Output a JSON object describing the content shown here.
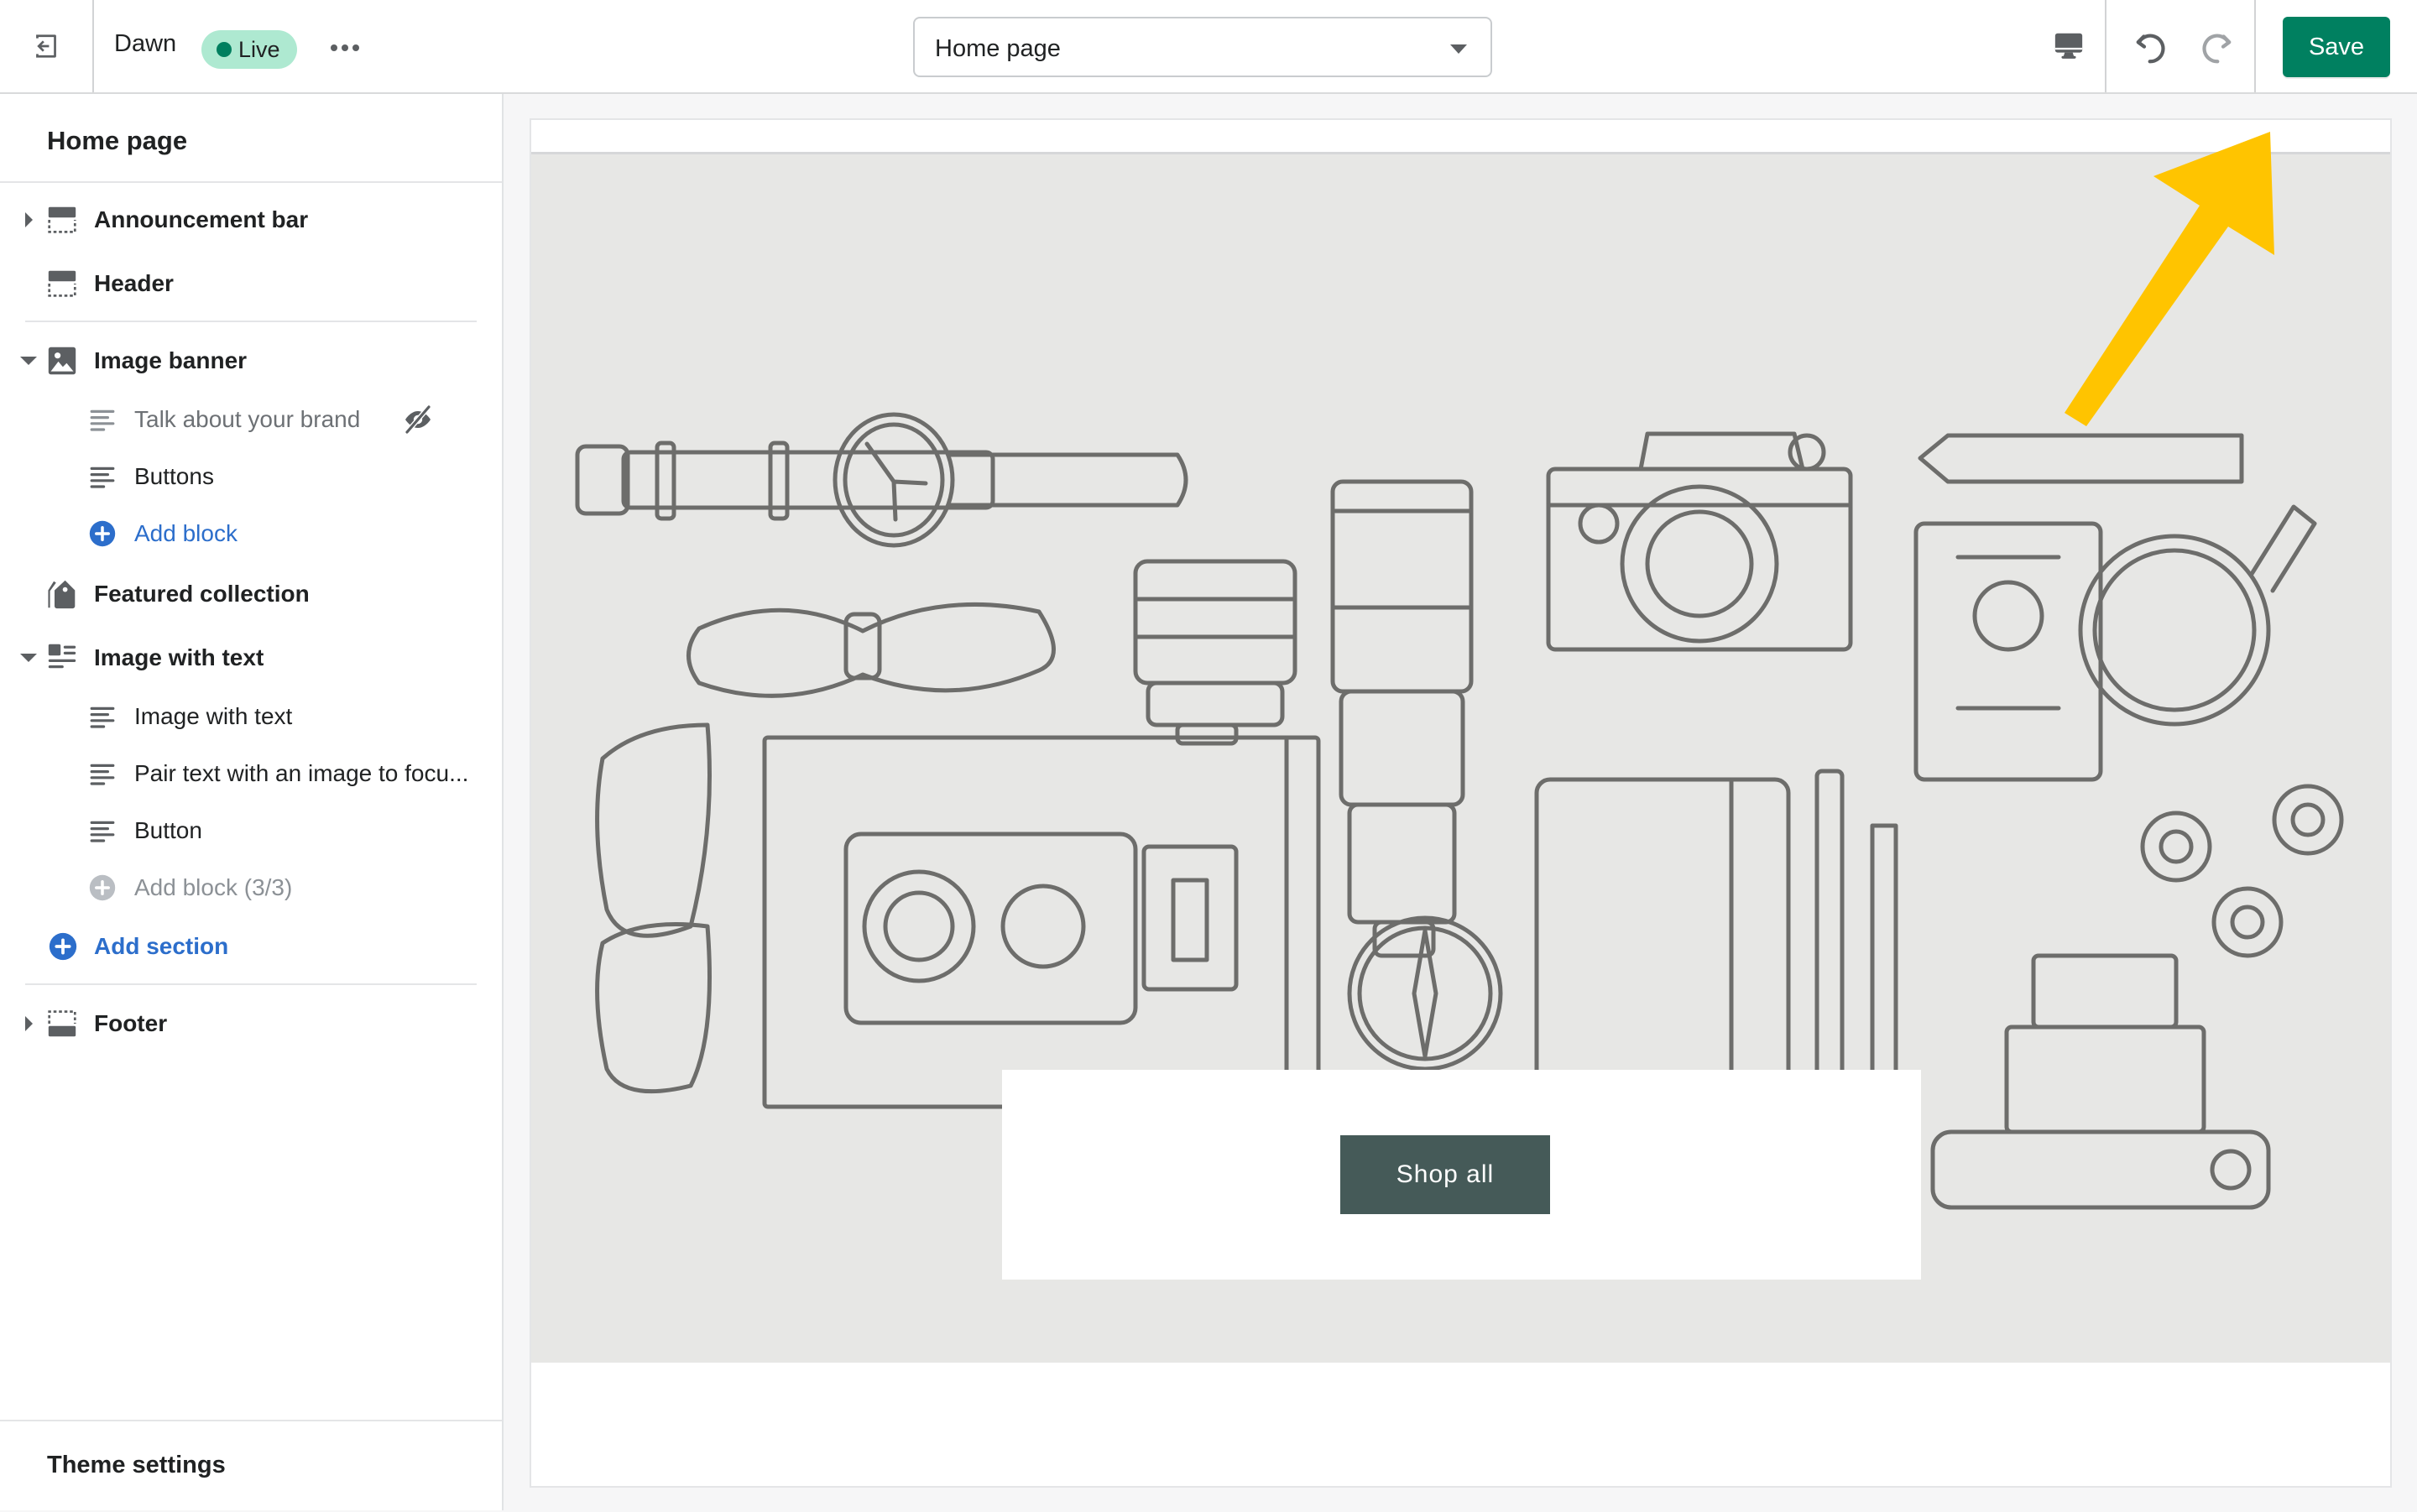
{
  "topbar": {
    "exit_icon": "exit-icon",
    "theme_name": "Dawn",
    "status_badge": "Live",
    "more_icon": "more-horizontal-icon",
    "page_selector": {
      "value": "Home page"
    },
    "device_icon": "desktop-icon",
    "undo_icon": "undo-icon",
    "redo_icon": "redo-icon",
    "save_label": "Save"
  },
  "sidebar": {
    "title": "Home page",
    "sections": [
      {
        "label": "Announcement bar",
        "icon": "section-header-icon",
        "expanded": false
      },
      {
        "label": "Header",
        "icon": "section-header-icon"
      },
      {
        "label": "Image banner",
        "icon": "image-icon",
        "expanded": true,
        "blocks": [
          {
            "label": "Talk about your brand",
            "hidden": true,
            "icon": "text-block-icon"
          },
          {
            "label": "Buttons",
            "icon": "text-block-icon"
          },
          {
            "label": "Add block",
            "icon": "add-circle-icon"
          }
        ]
      },
      {
        "label": "Featured collection",
        "icon": "tag-icon"
      },
      {
        "label": "Image with text",
        "icon": "image-with-text-icon",
        "expanded": true,
        "blocks": [
          {
            "label": "Image with text",
            "icon": "text-block-icon"
          },
          {
            "label": "Pair text with an image to focu...",
            "icon": "text-block-icon"
          },
          {
            "label": "Button",
            "icon": "text-block-icon"
          },
          {
            "label": "Add block (3/3)",
            "icon": "add-circle-icon",
            "disabled": true
          }
        ]
      },
      {
        "label": "Footer",
        "icon": "section-footer-icon",
        "expanded": false
      }
    ],
    "add_section": "Add section",
    "theme_settings": "Theme settings"
  },
  "preview": {
    "banner_button": "Shop all",
    "annotation": "yellow-arrow-pointing-to-save"
  },
  "colors": {
    "save_green": "#008060",
    "live_badge_bg": "#aee9d1",
    "live_dot": "#007f5f",
    "link_blue": "#2c6ecb",
    "shop_button": "#455a58",
    "banner_bg": "#e7e7e5",
    "arrow_yellow": "#ffc400"
  }
}
